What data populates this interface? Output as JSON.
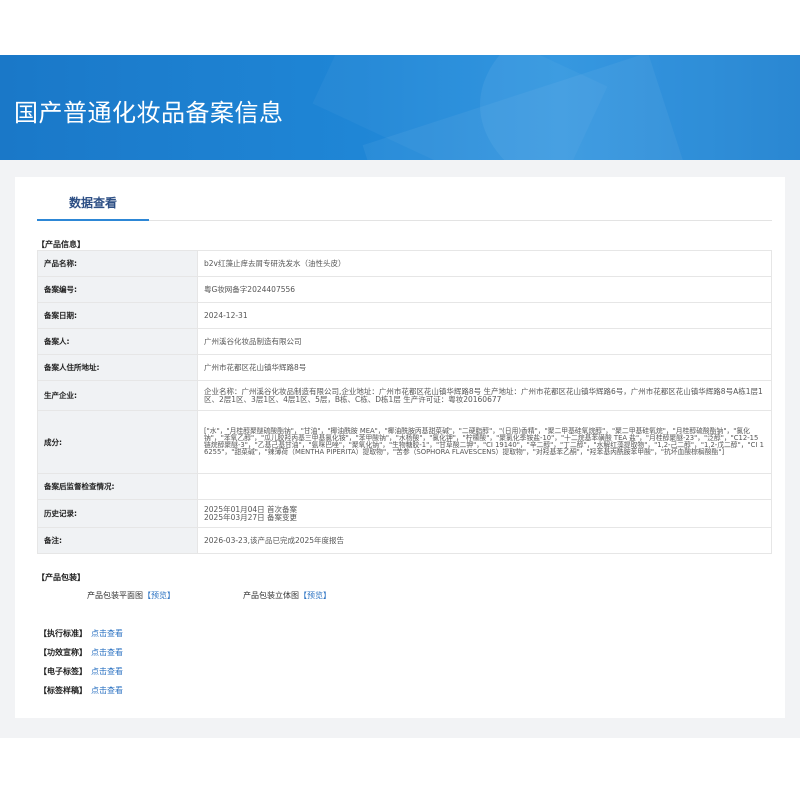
{
  "header": {
    "title": "国产普通化妆品备案信息"
  },
  "tabs": [
    {
      "label": "数据查看"
    }
  ],
  "product_info": {
    "section_title": "【产品信息】",
    "rows": [
      {
        "label": "产品名称:",
        "value": "b2v红藻止痒去屑专研洗发水（油性头皮）"
      },
      {
        "label": "备案编号:",
        "value": "粤G妆网备字2024407556"
      },
      {
        "label": "备案日期:",
        "value": "2024-12-31"
      },
      {
        "label": "备案人:",
        "value": "广州溪谷化妆品制造有限公司"
      },
      {
        "label": "备案人住所地址:",
        "value": "广州市花都区花山镇华辉路8号"
      },
      {
        "label": "生产企业:",
        "value": "企业名称：广州溪谷化妆品制造有限公司,企业地址：广州市花都区花山镇华辉路8号 生产地址：广州市花都区花山镇华辉路6号，广州市花都区花山镇华辉路8号A栋1层1区、2层1区、3层1区、4层1区、5层，B栋、C栋、D栋1层 生产许可证：粤妆20160677"
      },
      {
        "label": "成分:",
        "value": "[\"水\"，\"月桂醇聚醚硫酸酯钠\"，\"甘油\"，\"椰油酰胺 MEA\"，\"椰油酰胺丙基甜菜碱\"，\"二硬脂醇\"，\"(日用)香精\"，\"聚二甲基硅氧烷醇\"，\"聚二甲基硅氧烷\"，\"月桂醇硫酸酯钠\"，\"氯化钠\"，\"苯氧乙醇\"，\"瓜儿胶羟丙基三甲基氯化铵\"，\"苯甲酸钠\"，\"水杨酸\"，\"氯化钾\"，\"柠檬酸\"，\"聚氯化季铵盐-10\"，\"十二烷基苯磺酸 TEA 盐\"，\"月桂醇聚醚-23\"，\"泛醇\"，\"C12-15 链烷醇聚醚-3\"，\"乙基己基甘油\"，\"氨咪巴唑\"，\"聚氧化钠\"，\"生物糖胶-1\"，\"甘草酸二钾\"，\"CI 19140\"，\"辛二醇\"，\"丁二醇\"，\"水解红藻提取物\"，\"1,2-己二醇\"，\"1,2-戊二醇\"，\"CI 16255\"，\"甜菜碱\"，\"辣薄荷（MENTHA PIPERITA）提取物\"，\"苦参（SOPHORA FLAVESCENS）提取物\"，\"对羟基苯乙酮\"，\"羟苯基丙酰胺苯甲酸\"，\"抗坏血酸棕榈酸酯\"]"
      },
      {
        "label": "备案后监督检查情况:",
        "value": ""
      },
      {
        "label": "历史记录:",
        "value": [
          "2025年01月04日 首次备案",
          "2025年03月27日 备案变更"
        ]
      },
      {
        "label": "备注:",
        "value": "2026-03-23,该产品已完成2025年度报告"
      }
    ]
  },
  "packaging": {
    "section_title": "【产品包装】",
    "flat_label": "产品包装平面图",
    "flat_link": "【预览】",
    "solid_label": "产品包装立体图",
    "solid_link": "【预览】"
  },
  "links": [
    {
      "label": "【执行标准】",
      "link": "点击查看"
    },
    {
      "label": "【功效宣称】",
      "link": "点击查看"
    },
    {
      "label": "【电子标签】",
      "link": "点击查看"
    },
    {
      "label": "【标签样稿】",
      "link": "点击查看"
    }
  ],
  "colors": {
    "banner": "#1f86d6",
    "link": "#2b72c2",
    "tab_accent": "#2d87d6",
    "table_border": "#a9c6e3"
  }
}
